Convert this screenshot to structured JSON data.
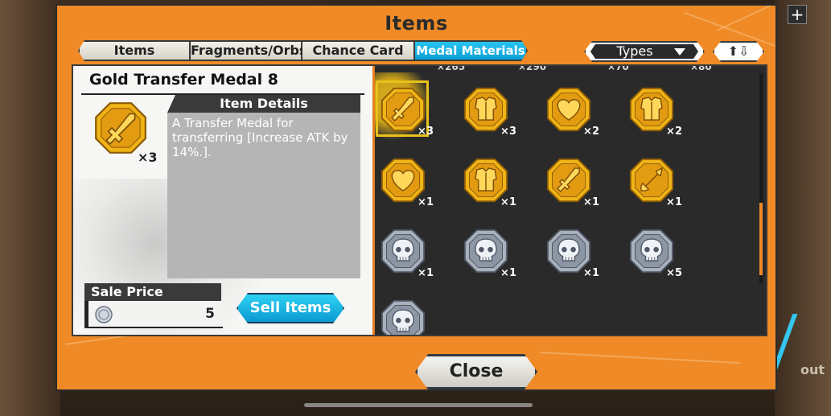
{
  "title": "Items",
  "tabs": [
    "Items",
    "Fragments/Orbs",
    "Chance Card",
    "Medal Materials"
  ],
  "active_tab": "Medal Materials",
  "types_dropdown": {
    "label": "Types",
    "icon": "chevron-down-icon"
  },
  "sort_icon": "⬆⇩",
  "background": {
    "plus_icon": "+",
    "out_text": "out"
  },
  "detail": {
    "name": "Gold Transfer Medal 8",
    "qty": "×3",
    "details_header": "Item Details",
    "description": "A Transfer Medal for transferring [Increase ATK by 14%.].",
    "sale_label": "Sale Price",
    "sale_value": "5",
    "sell_button": "Sell Items"
  },
  "top_counts": [
    "×265",
    "×290",
    "×70",
    "×80"
  ],
  "grid_items": [
    {
      "icon": "gold-sword-medal",
      "qty": "×3",
      "selected": true
    },
    {
      "icon": "gold-armor-medal",
      "qty": "×3"
    },
    {
      "icon": "gold-heart-medal",
      "qty": "×2"
    },
    {
      "icon": "gold-armor-medal",
      "qty": "×2"
    },
    {
      "icon": "gold-heart-medal",
      "qty": "×1"
    },
    {
      "icon": "gold-armor-medal",
      "qty": "×1"
    },
    {
      "icon": "gold-sword-medal",
      "qty": "×1"
    },
    {
      "icon": "gold-spear-medal",
      "qty": "×1"
    },
    {
      "icon": "silver-skull-medal",
      "qty": "×1"
    },
    {
      "icon": "silver-skull-medal",
      "qty": "×1"
    },
    {
      "icon": "silver-skull-medal",
      "qty": "×1"
    },
    {
      "icon": "silver-skull-medal",
      "qty": "×5"
    },
    {
      "icon": "silver-skull-medal",
      "qty": ""
    }
  ],
  "close_button": "Close",
  "colors": {
    "frame": "#ef8a26",
    "active_tab": "#0d9fd6",
    "gold": "#f0b417",
    "silver": "#a9b1bd"
  }
}
